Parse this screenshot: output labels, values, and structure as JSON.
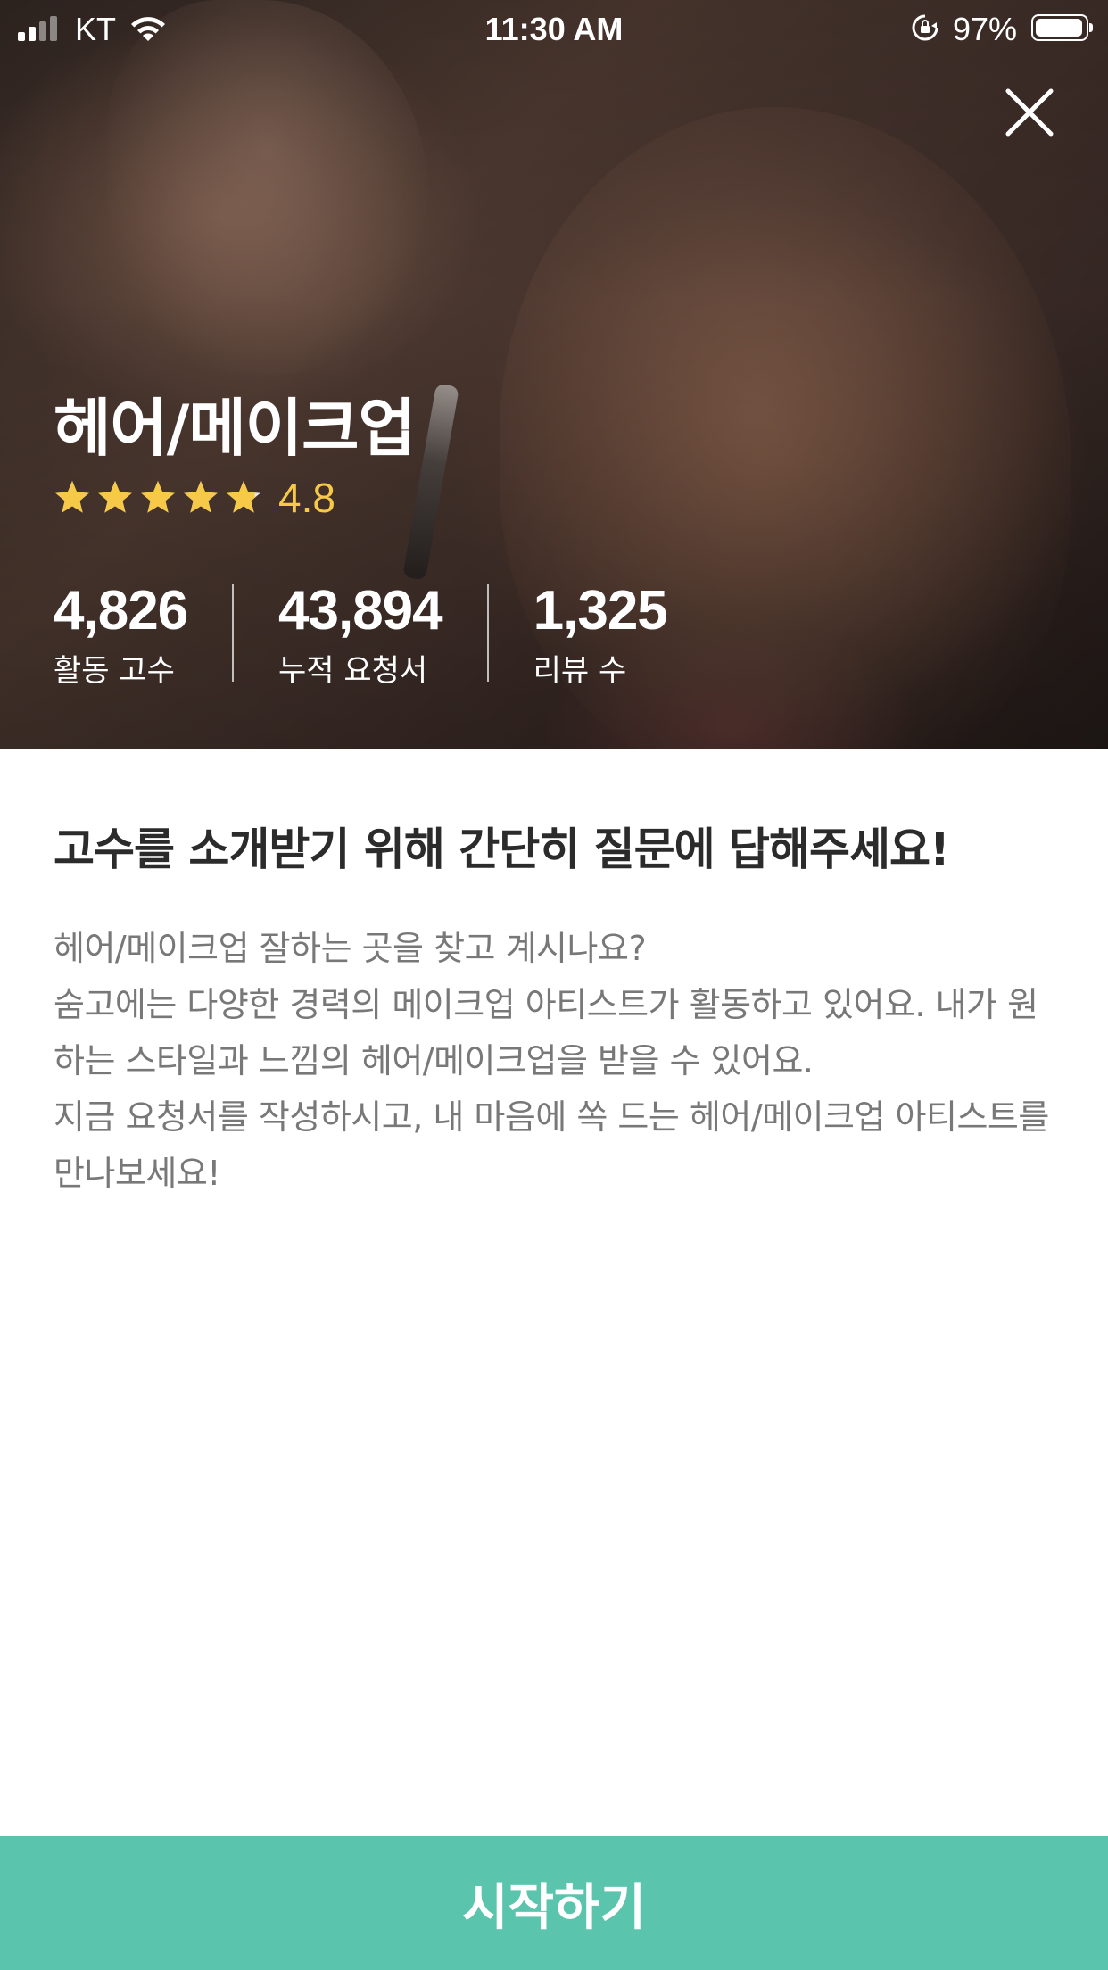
{
  "status_bar": {
    "carrier": "KT",
    "time": "11:30 AM",
    "battery_percent_text": "97%",
    "battery_level": 0.97
  },
  "hero": {
    "title": "헤어/메이크업",
    "rating": {
      "value_text": "4.8",
      "value": 4.8,
      "max": 5,
      "color": "#f7c948"
    },
    "stats": [
      {
        "value": "4,826",
        "label": "활동 고수"
      },
      {
        "value": "43,894",
        "label": "누적 요청서"
      },
      {
        "value": "1,325",
        "label": "리뷰 수"
      }
    ]
  },
  "content": {
    "headline": "고수를 소개받기 위해 간단히 질문에 답해주세요!",
    "description_lines": [
      "헤어/메이크업 잘하는 곳을 찾고 계시나요?",
      "숨고에는 다양한 경력의 메이크업 아티스트가 활동하고 있어요. 내가 원하는 스타일과 느낌의 헤어/메이크업을 받을 수 있어요.",
      "지금 요청서를 작성하시고, 내 마음에 쏙 드는 헤어/메이크업 아티스트를 만나보세요!"
    ]
  },
  "cta": {
    "label": "시작하기",
    "color": "#5bc4ad"
  },
  "icons": {
    "close": "close-icon",
    "star": "star-icon",
    "wifi": "wifi-icon",
    "rotation_lock": "rotation-lock-icon",
    "battery": "battery-icon",
    "signal": "signal-icon"
  }
}
